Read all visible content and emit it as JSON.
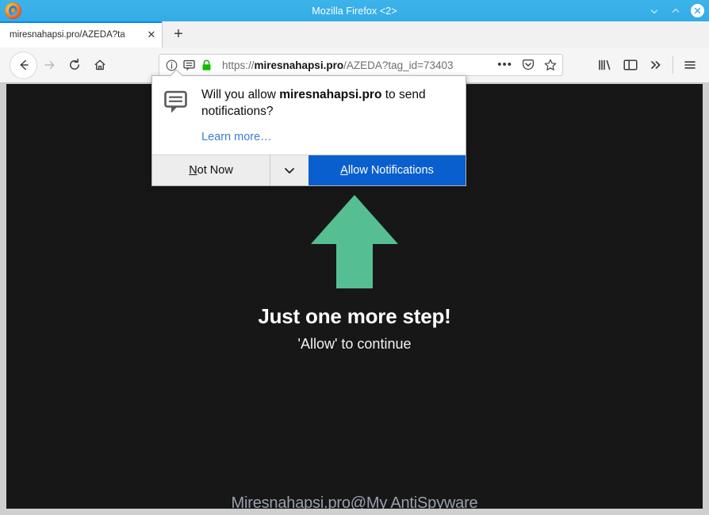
{
  "window": {
    "title": "Mozilla Firefox <2>",
    "controls": {
      "minimize": "⌄",
      "maximize": "⌃",
      "close": "×"
    },
    "logo_icon": "firefox-logo"
  },
  "tabs": {
    "items": [
      {
        "title": "miresnahapsi.pro/AZEDA?ta",
        "close_label": "✕"
      }
    ],
    "new_tab_label": "+"
  },
  "toolbar": {
    "back_icon": "back-arrow-icon",
    "forward_icon": "forward-arrow-icon",
    "reload_icon": "reload-icon",
    "home_icon": "home-icon",
    "library_icon": "library-icon",
    "sidebar_icon": "sidebar-icon",
    "overflow_label": "»",
    "menu_icon": "hamburger-menu-icon"
  },
  "urlbar": {
    "info_icon": "page-info-icon",
    "permission_icon": "notification-permission-icon",
    "lock_icon": "padlock-secure-icon",
    "scheme": "https://",
    "host": "miresnahapsi.pro",
    "path": "/AZEDA?tag_id=73403",
    "full_url": "https://miresnahapsi.pro/AZEDA?tag_id=73403",
    "page_actions_label": "•••",
    "pocket_icon": "pocket-icon",
    "bookmark_icon": "star-bookmark-icon"
  },
  "popup": {
    "icon": "speech-bubble-notification-icon",
    "question_prefix": "Will you allow ",
    "question_host": "miresnahapsi.pro",
    "question_suffix": " to send notifications?",
    "learn_more": "Learn more…",
    "not_now_first": "N",
    "not_now_rest": "ot Now",
    "dropdown_icon": "chevron-down-icon",
    "allow_first": "A",
    "allow_rest": "llow Notifications"
  },
  "page": {
    "arrow_icon": "up-arrow-icon",
    "headline": "Just one more step!",
    "subline": "'Allow' to continue",
    "watermark": "Miresnahapsi.pro@My AntiSpyware"
  },
  "colors": {
    "titlebar": "#33ace6",
    "page_background": "#171717",
    "arrow_green": "#55bf92",
    "allow_button_blue": "#0a5fce",
    "link_blue": "#3b7dd8",
    "lock_green": "#12bc00",
    "tab_accent": "#0a84ff"
  }
}
